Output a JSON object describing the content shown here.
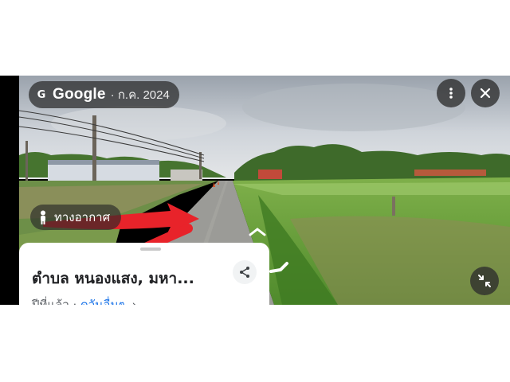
{
  "header": {
    "brand": "Google",
    "date": "· ก.ค. 2024",
    "brand_icon": "google-g-icon"
  },
  "controls": {
    "more_icon": "more-vert-icon",
    "close_icon": "close-icon",
    "collapse_icon": "collapse-arrows-icon"
  },
  "scene": {
    "description_icon": "street-view-photo",
    "bubble_label": "ทางอากาศ",
    "bubble_icon": "pegman-icon"
  },
  "card": {
    "title": "ตำบล หนองแสง, มหา...",
    "subtitle": "ปีที่แล้ว ·",
    "link_label": "ดูวันอื่นๆ",
    "chevron": "›",
    "share_icon": "share-icon"
  },
  "colors": {
    "sky": "#c9cfd6",
    "grass": "#5f9a3a",
    "road": "#9a9a96",
    "arrow": "#e8232a",
    "link": "#1a73e8"
  }
}
